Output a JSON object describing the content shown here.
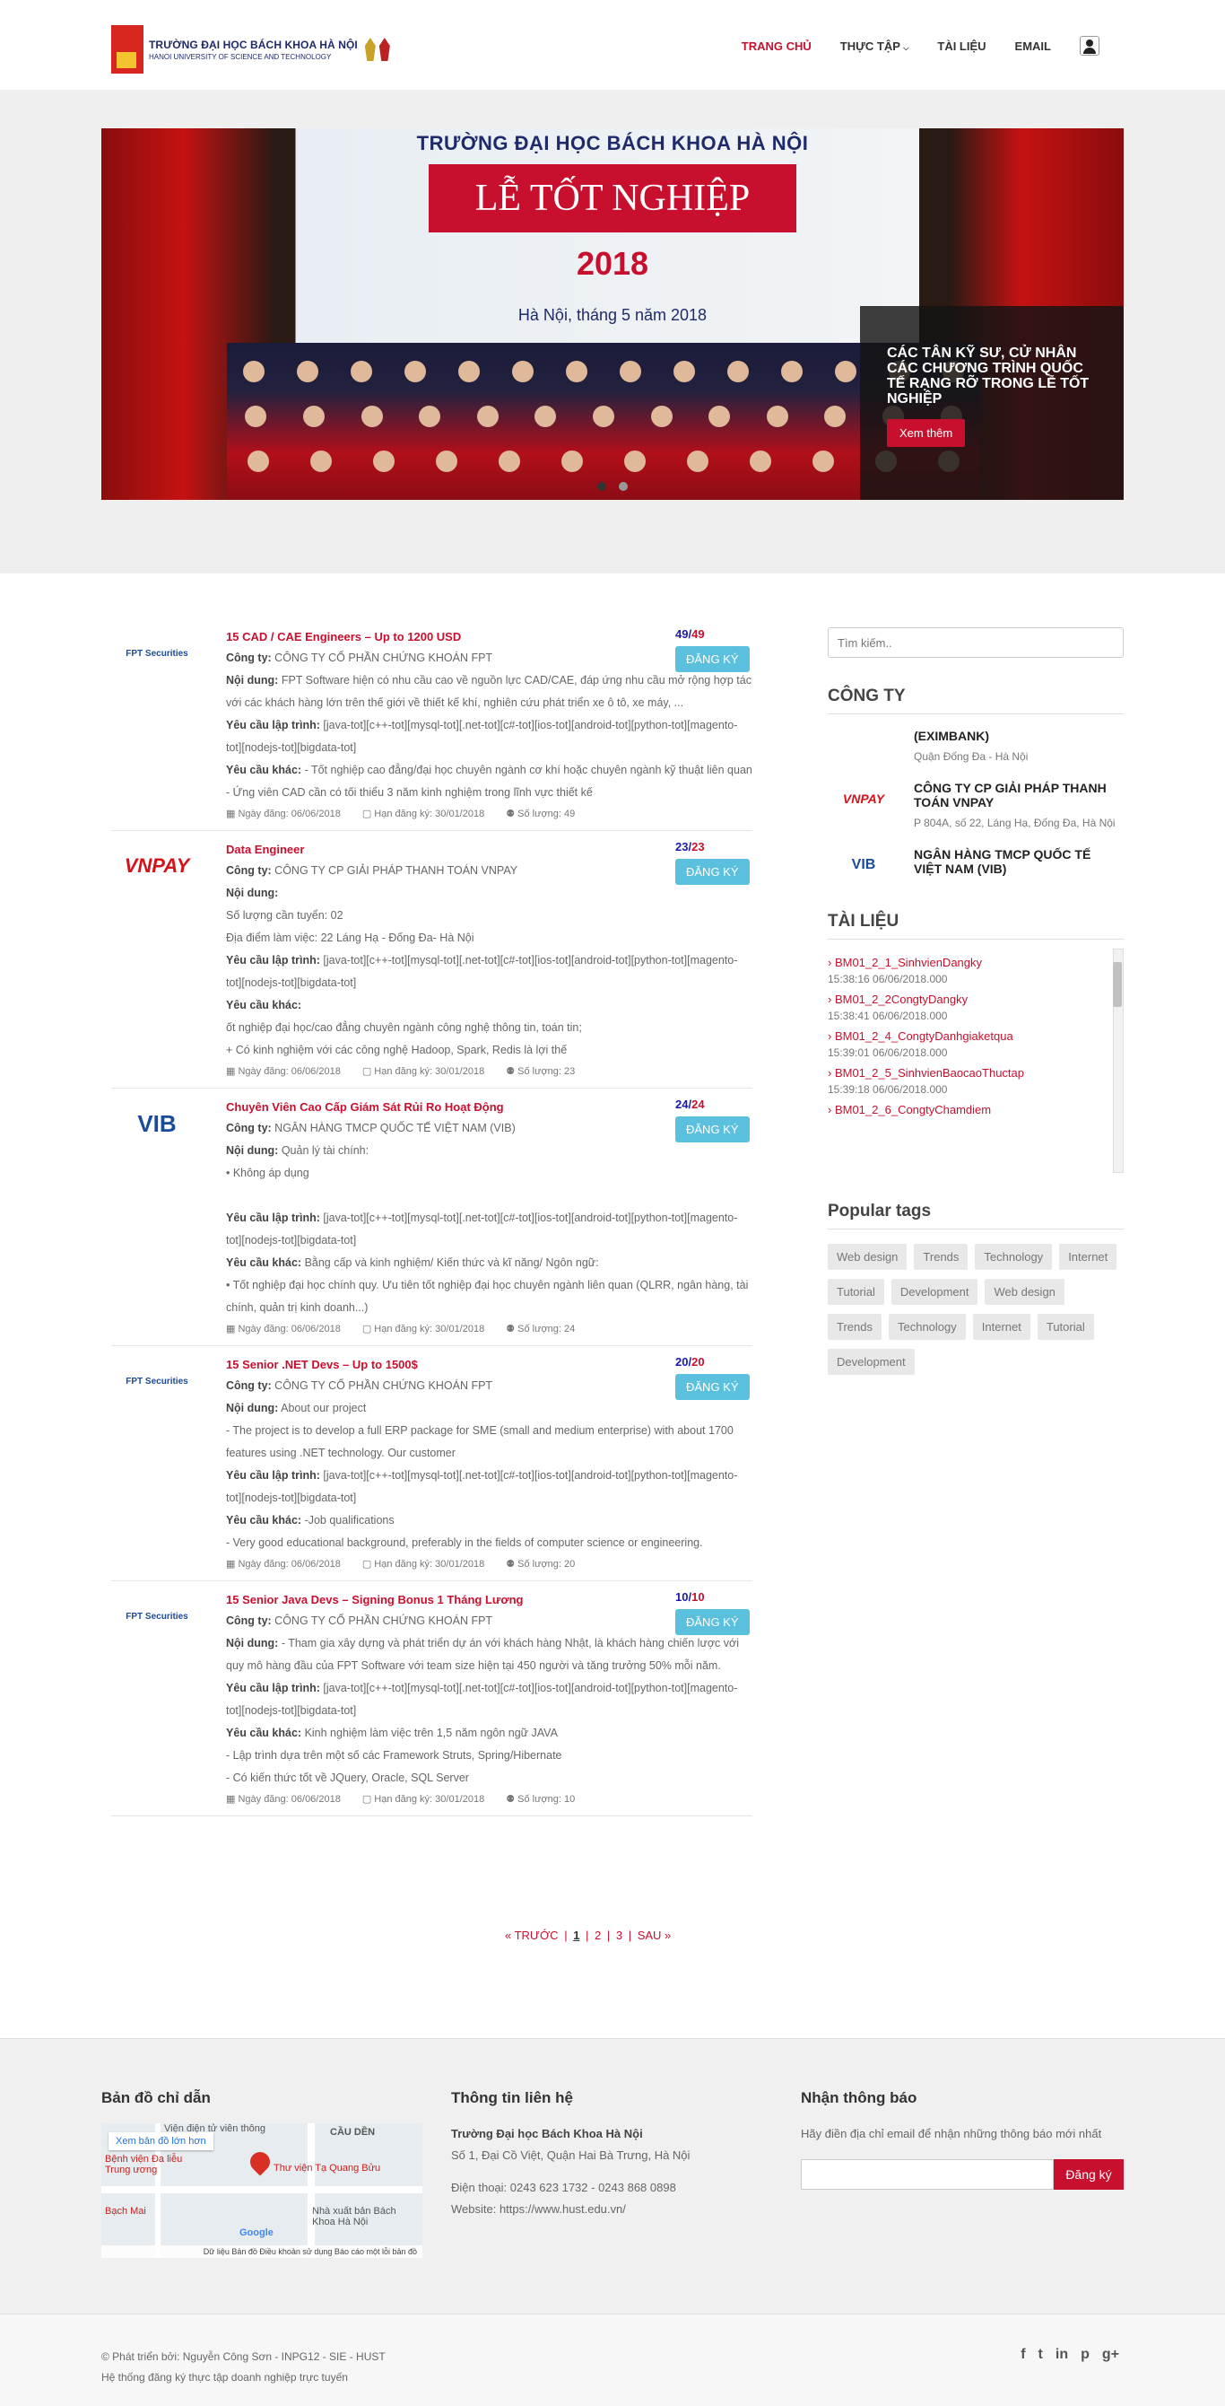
{
  "header": {
    "logo_line1": "TRƯỜNG ĐẠI HỌC BÁCH KHOA HÀ NỘI",
    "logo_line2": "HANOI UNIVERSITY OF SCIENCE AND TECHNOLOGY",
    "nav": [
      {
        "label": "TRANG CHỦ",
        "active": true
      },
      {
        "label": "THỰC TẬP",
        "active": false
      },
      {
        "label": "TÀI LIỆU",
        "active": false
      },
      {
        "label": "EMAIL",
        "active": false
      }
    ]
  },
  "banner": {
    "school": "TRƯỜNG ĐẠI HỌC BÁCH KHOA HÀ NỘI",
    "event": "LỄ TỐT NGHIỆP",
    "year": "2018",
    "place": "Hà Nội, tháng 5 năm 2018",
    "caption": "CÁC TÂN KỸ SƯ, CỬ NHÂN CÁC CHƯƠNG TRÌNH QUỐC TẾ RẠNG RỠ TRONG LỄ TỐT NGHIỆP",
    "button": "Xem thêm"
  },
  "jobs": [
    {
      "logo": "FPT Securities",
      "title": "15 CAD / CAE Engineers – Up to 1200 USD",
      "company_label": "Công ty:",
      "company": "CÔNG TY CỔ PHẦN CHỨNG KHOÁN FPT",
      "content_label": "Nội dung:",
      "content": "FPT Software hiện có nhu cầu cao về nguồn lực CAD/CAE, đáp ứng nhu cầu mở rộng hợp tác với các khách hàng lớn trên thế giới về thiết kế khí, nghiên cứu phát triển xe ô tô, xe máy, ...",
      "prog_label": "Yêu cầu lập trình:",
      "prog": "[java-tot][c++-tot][mysql-tot][.net-tot][c#-tot][ios-tot][android-tot][python-tot][magento-tot][nodejs-tot][bigdata-tot]",
      "other_label": "Yêu cầu khác:",
      "other": "- Tốt nghiệp cao đẳng/đại học chuyên ngành cơ khí hoặc chuyên ngành kỹ thuật liên quan",
      "other2": "- Ứng viên CAD cần có tối thiểu 3 năm kinh nghiệm trong lĩnh vực thiết kế",
      "posted": "Ngày đăng: 06/06/2018",
      "deadline": "Hạn đăng ký: 30/01/2018",
      "quantity": "Số lượng: 49",
      "count": "49",
      "total": "49",
      "button": "ĐĂNG KÝ"
    },
    {
      "logo": "VNPAY",
      "title": "Data Engineer",
      "company_label": "Công ty:",
      "company": "CÔNG TY CP GIẢI PHÁP THANH TOÁN VNPAY",
      "content_label": "Nội dung:",
      "content": "Số lượng cần tuyển: 02",
      "content2": "Địa điểm làm việc: 22 Láng Hạ - Đống Đa- Hà Nội",
      "prog_label": "Yêu cầu lập trình:",
      "prog": "[java-tot][c++-tot][mysql-tot][.net-tot][c#-tot][ios-tot][android-tot][python-tot][magento-tot][nodejs-tot][bigdata-tot]",
      "other_label": "Yêu cầu khác:",
      "other": "ốt nghiệp đại học/cao đẳng chuyên ngành công nghệ thông tin, toán tin;",
      "other2": "+     Có kinh nghiệm với các công nghệ Hadoop, Spark, Redis là lợi thế",
      "posted": "Ngày đăng: 06/06/2018",
      "deadline": "Hạn đăng ký: 30/01/2018",
      "quantity": "Số lượng: 23",
      "count": "23",
      "total": "23",
      "button": "ĐĂNG KÝ"
    },
    {
      "logo": "VIB",
      "title": "Chuyên Viên Cao Cấp Giám Sát Rủi Ro Hoạt Động",
      "company_label": "Công ty:",
      "company": "NGÂN HÀNG TMCP QUỐC TẾ VIỆT NAM (VIB)",
      "content_label": "Nội dung:",
      "content": "Quản lý tài chính:",
      "content2": "• Không áp dụng",
      "prog_label": "Yêu cầu lập trình:",
      "prog": "[java-tot][c++-tot][mysql-tot][.net-tot][c#-tot][ios-tot][android-tot][python-tot][magento-tot][nodejs-tot][bigdata-tot]",
      "other_label": "Yêu cầu khác:",
      "other": "Bằng cấp và kinh nghiệm/ Kiến thức và kĩ năng/ Ngôn ngữ:",
      "other2": "• Tốt nghiệp đại học chính quy. Ưu tiên tốt nghiệp đại học chuyên ngành liên quan (QLRR, ngân hàng, tài chính, quản trị kinh doanh...)",
      "posted": "Ngày đăng: 06/06/2018",
      "deadline": "Hạn đăng ký: 30/01/2018",
      "quantity": "Số lượng: 24",
      "count": "24",
      "total": "24",
      "button": "ĐĂNG KÝ"
    },
    {
      "logo": "FPT Securities",
      "title": "15 Senior .NET Devs – Up to 1500$",
      "company_label": "Công ty:",
      "company": "CÔNG TY CỔ PHẦN CHỨNG KHOÁN FPT",
      "content_label": "Nội dung:",
      "content": "About our project",
      "content2": "- The project is to develop a full ERP package for SME (small and medium enterprise) with about 1700 features using .NET technology. Our customer",
      "prog_label": "Yêu cầu lập trình:",
      "prog": "[java-tot][c++-tot][mysql-tot][.net-tot][c#-tot][ios-tot][android-tot][python-tot][magento-tot][nodejs-tot][bigdata-tot]",
      "other_label": "Yêu cầu khác:",
      "other": "-Job qualifications",
      "other2": "- Very good educational background, preferably in the fields of computer science or engineering.",
      "posted": "Ngày đăng: 06/06/2018",
      "deadline": "Hạn đăng ký: 30/01/2018",
      "quantity": "Số lượng: 20",
      "count": "20",
      "total": "20",
      "button": "ĐĂNG KÝ"
    },
    {
      "logo": "FPT Securities",
      "title": "15 Senior Java Devs – Signing Bonus 1 Tháng Lương",
      "company_label": "Công ty:",
      "company": "CÔNG TY CỔ PHẦN CHỨNG KHOÁN FPT",
      "content_label": "Nội dung:",
      "content": "- Tham gia xây dựng và phát triển dự án với khách hàng Nhật, là khách hàng chiến lược với quy mô hàng đầu của FPT Software với team size hiện tại 450 người và tăng trưởng 50% mỗi năm.",
      "prog_label": "Yêu cầu lập trình:",
      "prog": "[java-tot][c++-tot][mysql-tot][.net-tot][c#-tot][ios-tot][android-tot][python-tot][magento-tot][nodejs-tot][bigdata-tot]",
      "other_label": "Yêu cầu khác:",
      "other": "Kinh nghiệm làm việc trên 1,5 năm ngôn ngữ JAVA",
      "other2": "- Lập trình dựa trên một số các Framework Struts, Spring/Hibernate",
      "other3": "- Có kiến thức tốt về JQuery, Oracle, SQL Server",
      "posted": "Ngày đăng: 06/06/2018",
      "deadline": "Hạn đăng ký: 30/01/2018",
      "quantity": "Số lượng: 10",
      "count": "10",
      "total": "10",
      "button": "ĐĂNG KÝ"
    }
  ],
  "pager": {
    "prev": "« TRƯỚC",
    "p1": "1",
    "p2": "2",
    "p3": "3",
    "next": "SAU »"
  },
  "sidebar": {
    "search_placeholder": "Tìm kiếm..",
    "companies_heading": "CÔNG TY",
    "companies": [
      {
        "name": "(EXIMBANK)",
        "address": "Quận Đống Đa - Hà Nội",
        "logo": ""
      },
      {
        "name": "CÔNG TY CP GIẢI PHÁP THANH TOÁN VNPAY",
        "address": "P 804A, số 22, Láng Hạ, Đống Đa, Hà Nội",
        "logo": "VNPAY"
      },
      {
        "name": "NGÂN HÀNG TMCP QUỐC TẾ VIỆT NAM (VIB)",
        "address": "",
        "logo": "VIB"
      }
    ],
    "docs_heading": "TÀI LIỆU",
    "docs": [
      {
        "name": "BM01_2_1_SinhvienDangky",
        "time": "15:38:16 06/06/2018.000"
      },
      {
        "name": "BM01_2_2CongtyDangky",
        "time": "15:38:41 06/06/2018.000"
      },
      {
        "name": "BM01_2_4_CongtyDanhgiaketqua",
        "time": "15:39:01 06/06/2018.000"
      },
      {
        "name": "BM01_2_5_SinhvienBaocaoThuctap",
        "time": "15:39:18 06/06/2018.000"
      },
      {
        "name": "BM01_2_6_CongtyChamdiem",
        "time": ""
      }
    ],
    "tags_heading": "Popular tags",
    "tags": [
      "Web design",
      "Trends",
      "Technology",
      "Internet",
      "Tutorial",
      "Development",
      "Web design",
      "Trends",
      "Technology",
      "Internet",
      "Tutorial",
      "Development"
    ]
  },
  "footer": {
    "map_heading": "Bản đồ chỉ dẫn",
    "map_link": "Xem bản đồ lớn hơn",
    "map_place": "Thư viện Tạ Quang Bửu",
    "map_label1": "Viện điện tử viễn thông",
    "map_label2": "Bệnh viện Đa liễu Trung ương",
    "map_label3": "Nhà xuất bản Bách Khoa Hà Nội",
    "map_label4": "Bạch Mai",
    "map_label5": "CẦU DỀN",
    "map_footer": "Dữ liệu Bản đồ   Điều khoản sử dụng   Báo cáo một lỗi bản đồ",
    "map_brand": "Google",
    "contact_heading": "Thông tin liên hệ",
    "contact_name": "Trường Đại học Bách Khoa Hà Nội",
    "contact_addr": "Số 1, Đại Cồ Việt, Quận Hai Bà Trưng, Hà Nội",
    "contact_phone": "Điện thoại: 0243 623 1732 - 0243 868 0898",
    "contact_web": "Website: https://www.hust.edu.vn/",
    "newsletter_heading": "Nhận thông báo",
    "newsletter_text": "Hãy điền địa chỉ email để nhận những thông báo mới nhất",
    "newsletter_button": "Đăng ký",
    "copyright1": "© Phát triển bởi: Nguyễn Công Sơn - INPG12 - SIE - HUST",
    "copyright2": "Hệ thống đăng ký thực tập doanh nghiệp trực tuyến",
    "social": [
      "f",
      "t",
      "in",
      "p",
      "g+"
    ]
  }
}
